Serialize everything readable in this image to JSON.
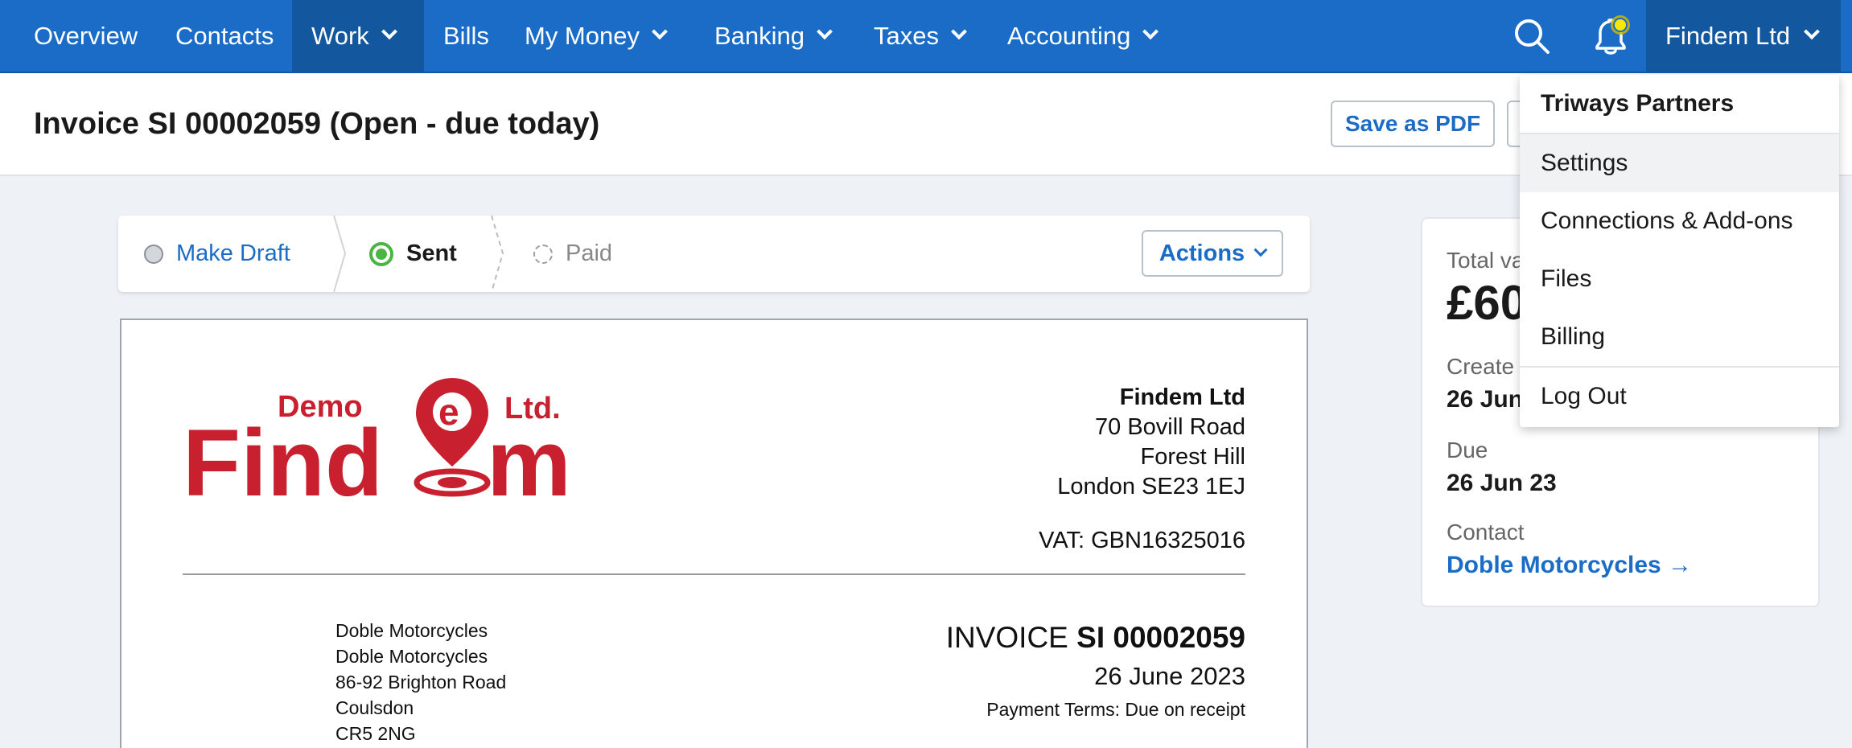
{
  "nav": {
    "items": [
      {
        "label": "Overview"
      },
      {
        "label": "Contacts"
      },
      {
        "label": "Work"
      },
      {
        "label": "Bills"
      },
      {
        "label": "My Money"
      },
      {
        "label": "Banking"
      },
      {
        "label": "Taxes"
      },
      {
        "label": "Accounting"
      }
    ],
    "org_name": "Findem Ltd"
  },
  "header": {
    "title": "Invoice SI 00002059 (Open - due today)",
    "save_pdf_label": "Save as PDF"
  },
  "status": {
    "steps": [
      {
        "label": "Make Draft"
      },
      {
        "label": "Sent"
      },
      {
        "label": "Paid"
      }
    ],
    "actions_label": "Actions"
  },
  "invoice": {
    "logo": {
      "word1": "Demo",
      "word2": "Ltd.",
      "word3": "Find",
      "word4": "m"
    },
    "company": {
      "name": "Findem Ltd",
      "address": [
        "70 Bovill Road",
        "Forest Hill",
        "London SE23 1EJ"
      ],
      "vat": "VAT: GBN16325016"
    },
    "customer": [
      "Doble Motorcycles",
      "Doble Motorcycles",
      "86-92 Brighton Road",
      "Coulsdon",
      "CR5 2NG"
    ],
    "title_prefix": "INVOICE",
    "number": "SI 00002059",
    "date": "26 June 2023",
    "terms": "Payment Terms: Due on receipt"
  },
  "summary": {
    "total_label": "Total va",
    "total_value": "£60",
    "created_label": "Create",
    "created_value": "26 Jun",
    "due_label": "Due",
    "due_value": "26 Jun 23",
    "contact_label": "Contact",
    "contact_value": "Doble Motorcycles →"
  },
  "dropdown": {
    "heading": "Triways Partners",
    "items": [
      {
        "label": "Settings"
      },
      {
        "label": "Connections & Add-ons"
      },
      {
        "label": "Files"
      },
      {
        "label": "Billing"
      },
      {
        "label": "Log Out"
      }
    ]
  },
  "colors": {
    "brand_blue": "#1a6cc7",
    "logo_red": "#c8202f",
    "sent_green": "#4bb543",
    "notification_yellow": "#ffe600"
  }
}
